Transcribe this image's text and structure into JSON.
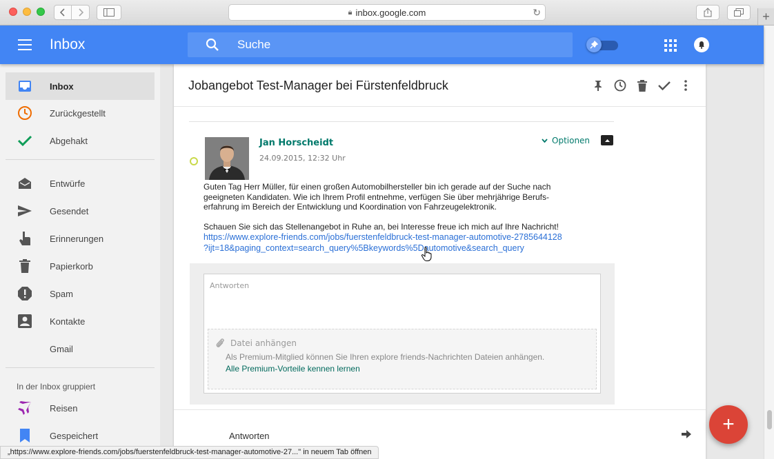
{
  "browser": {
    "url": "inbox.google.com"
  },
  "header": {
    "title": "Inbox",
    "search_placeholder": "Suche"
  },
  "sidebar": {
    "items": [
      {
        "label": "Inbox",
        "icon": "inbox-icon"
      },
      {
        "label": "Zurückgestellt",
        "icon": "clock-icon"
      },
      {
        "label": "Abgehakt",
        "icon": "check-icon"
      },
      {
        "label": "Entwürfe",
        "icon": "drafts-icon"
      },
      {
        "label": "Gesendet",
        "icon": "send-icon"
      },
      {
        "label": "Erinnerungen",
        "icon": "reminder-icon"
      },
      {
        "label": "Papierkorb",
        "icon": "trash-icon"
      },
      {
        "label": "Spam",
        "icon": "spam-icon"
      },
      {
        "label": "Kontakte",
        "icon": "contacts-icon"
      },
      {
        "label": "Gmail",
        "icon": ""
      }
    ],
    "group_heading": "In der Inbox gruppiert",
    "groups": [
      {
        "label": "Reisen",
        "icon": "plane-icon"
      },
      {
        "label": "Gespeichert",
        "icon": "bookmark-icon"
      }
    ]
  },
  "thread": {
    "subject": "Jobangebot Test-Manager bei Fürstenfeldbruck",
    "message": {
      "sender": "Jan Horscheidt",
      "date": "24.09.2015, 12:32 Uhr",
      "options_label": "Optionen",
      "body_line1": "Guten Tag Herr Müller, für einen großen Automobilhersteller bin ich gerade auf der Suche nach",
      "body_line2": "geeigneten Kandidaten. Wie ich Ihrem Profil entnehme, verfügen Sie über mehrjährige Berufs-",
      "body_line3": "erfahrung im Bereich der Entwicklung und Koordination von Fahrzeugelektronik.",
      "body_line4": "Schauen Sie sich das Stellenangebot in Ruhe an, bei Interesse freue ich mich auf Ihre Nachricht!",
      "link_line1": "https://www.explore-friends.com/jobs/fuerstenfeldbruck-test-manager-automotive-2785644128",
      "link_line2": "?ijt=18&paging_context=search_query%5Bkeywords%5Dautomotive&search_query"
    },
    "reply": {
      "placeholder": "Antworten",
      "attach_label": "Datei anhängen",
      "attach_note": "Als Premium-Mitglied können Sie Ihren explore friends-Nachrichten Dateien anhängen.",
      "attach_link": "Alle Premium-Vorteile kennen lernen"
    },
    "footer_label": "Antworten"
  },
  "fab_symbol": "+",
  "status_bar": "„https://www.explore-friends.com/jobs/fuerstenfeldbruck-test-manager-automotive-27...\" in neuem Tab öffnen",
  "colors": {
    "header_blue": "#4285f4",
    "accent_teal": "#00796b",
    "fab_red": "#db4437",
    "link_blue": "#2a6fd6"
  }
}
